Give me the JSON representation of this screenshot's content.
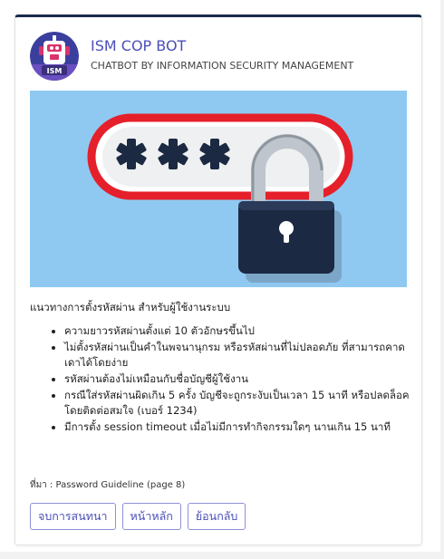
{
  "bot": {
    "name": "ISM COP BOT",
    "subtitle": "CHATBOT BY INFORMATION SECURITY MANAGEMENT",
    "avatar_icon": "robot-icon",
    "avatar_badge": "ISM"
  },
  "banner": {
    "icon": "password-lock-icon",
    "masked_text": "***"
  },
  "message": {
    "intro": "แนวทางการตั้งรหัสผ่าน สำหรับผู้ใช้งานระบบ",
    "rules": [
      "ความยาวรหัสผ่านตั้งแต่ 10 ตัวอักษรขึ้นไป",
      "ไม่ตั้งรหัสผ่านเป็นคำในพจนานุกรม หรือรหัสผ่านที่ไม่ปลอดภัย ที่สามารถคาดเดาได้โดยง่าย",
      "รหัสผ่านต้องไม่เหมือนกับชื่อบัญชีผู้ใช้งาน",
      "กรณีใส่รหัสผ่านผิดเกิน 5 ครั้ง บัญชีจะถูกระงับเป็นเวลา 15 นาที หรือปลดล็อคโดยติดต่อสมใจ (เบอร์ 1234)",
      "มีการตั้ง session timeout เมื่อไม่มีการทำกิจกรรมใดๆ นานเกิน 15 นาที"
    ],
    "source": "ที่มา : Password Guideline (page 8)"
  },
  "actions": {
    "end_chat": "จบการสนทนา",
    "home": "หน้าหลัก",
    "back": "ย้อนกลับ"
  },
  "colors": {
    "accent": "#4b4fb8",
    "top_border": "#1b2a4a",
    "banner_bg": "#8fc9f1",
    "password_field_border": "#e5202b",
    "lock_body": "#1c2942"
  }
}
